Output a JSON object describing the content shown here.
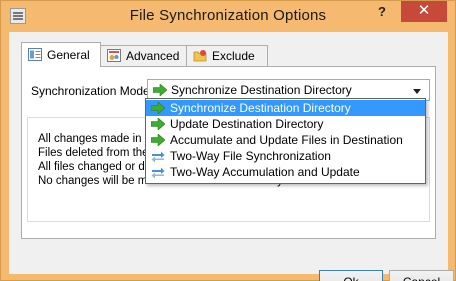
{
  "window": {
    "title": "File Synchronization Options",
    "help_label": "?",
    "close_label": "✕",
    "icons": {
      "app": "app-icon"
    },
    "colors": {
      "titlebar": "#f5b96f",
      "close": "#c7493a",
      "selection": "#3399ff"
    }
  },
  "tabs": [
    {
      "label": "General",
      "icon": "general-tab-icon",
      "active": true
    },
    {
      "label": "Advanced",
      "icon": "advanced-tab-icon",
      "active": false
    },
    {
      "label": "Exclude",
      "icon": "exclude-tab-icon",
      "active": false
    }
  ],
  "sync_mode": {
    "label": "Synchronization Mode:",
    "selected": "Synchronize Destination Directory",
    "options": [
      {
        "label": "Synchronize Destination Directory",
        "icon": "green-arrow-icon"
      },
      {
        "label": "Update Destination Directory",
        "icon": "green-arrow-icon"
      },
      {
        "label": "Accumulate and Update Files in Destination",
        "icon": "green-arrow-icon"
      },
      {
        "label": "Two-Way File Synchronization",
        "icon": "two-way-sync-icon"
      },
      {
        "label": "Two-Way Accumulation and Update",
        "icon": "two-way-sync-icon"
      }
    ]
  },
  "description": {
    "lines": [
      "All changes made in t",
      "Files deleted from the",
      "All files changed or de",
      "No changes will be made in the source directory."
    ]
  },
  "buttons": {
    "ok": "Ok",
    "cancel": "Cancel"
  }
}
